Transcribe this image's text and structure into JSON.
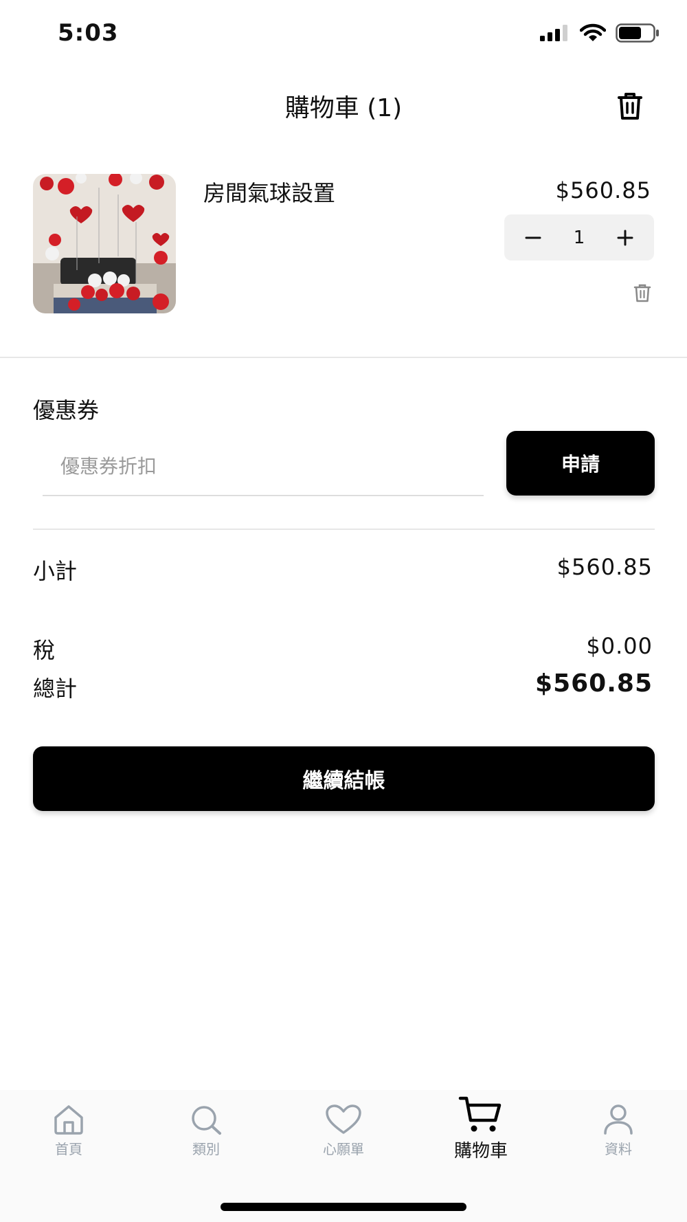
{
  "status_bar": {
    "time": "5:03"
  },
  "header": {
    "title": "購物車 (1)"
  },
  "cart": {
    "item": {
      "name": "房間氣球設置",
      "price": "$560.85",
      "quantity": "1",
      "minus": "−",
      "plus": "+"
    }
  },
  "coupon": {
    "label": "優惠券",
    "placeholder": "優惠券折扣",
    "apply_label": "申請"
  },
  "summary": {
    "subtotal_label": "小計",
    "subtotal_value": "$560.85",
    "tax_label": "稅",
    "tax_value": "$0.00",
    "total_label": "總計",
    "total_value": "$560.85"
  },
  "checkout_label": "繼續結帳",
  "nav": {
    "items": [
      {
        "label": "首頁",
        "icon": "home-icon"
      },
      {
        "label": "類別",
        "icon": "search-icon"
      },
      {
        "label": "心願單",
        "icon": "heart-icon"
      },
      {
        "label": "購物車",
        "icon": "cart-icon",
        "active": true
      },
      {
        "label": "資料",
        "icon": "user-icon"
      }
    ]
  },
  "colors": {
    "accent": "#000000",
    "inactive_nav": "#9aa3ad",
    "qty_bg": "#f1f1f1"
  }
}
